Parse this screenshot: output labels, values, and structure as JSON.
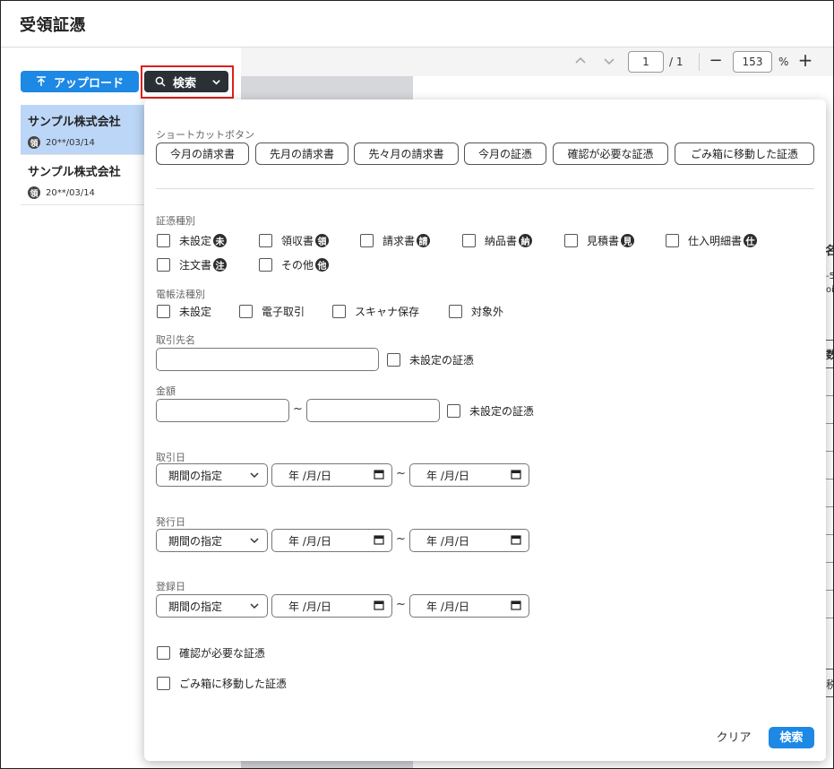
{
  "app": {
    "title": "受領証憑"
  },
  "sidebar": {
    "upload_label": "アップロード",
    "search_label": "検索",
    "items": [
      {
        "title": "サンプル株式会社",
        "badge": "領",
        "date": "20**/03/14",
        "selected": true
      },
      {
        "title": "サンプル株式会社",
        "badge": "領",
        "date": "20**/03/14",
        "selected": false
      }
    ]
  },
  "viewer": {
    "page": "1",
    "page_total": "/ 1",
    "zoom": "153",
    "zoom_unit": "%",
    "minus": "−",
    "plus": "+",
    "doc_fragments": [
      "名",
      "-5",
      "oi",
      "数",
      "税"
    ]
  },
  "search_panel": {
    "shortcut_label": "ショートカットボタン",
    "shortcuts": [
      "今月の請求書",
      "先月の請求書",
      "先々月の請求書",
      "今月の証憑",
      "確認が必要な証憑",
      "ごみ箱に移動した証憑"
    ],
    "doc_type_label": "証憑種別",
    "doc_types": [
      {
        "label": "未設定",
        "tag": "未"
      },
      {
        "label": "領収書",
        "tag": "領"
      },
      {
        "label": "請求書",
        "tag": "請"
      },
      {
        "label": "納品書",
        "tag": "納"
      },
      {
        "label": "見積書",
        "tag": "見"
      },
      {
        "label": "仕入明細書",
        "tag": "仕"
      },
      {
        "label": "注文書",
        "tag": "注"
      },
      {
        "label": "その他",
        "tag": "他"
      }
    ],
    "ledger_label": "電帳法種別",
    "ledger_types": [
      "未設定",
      "電子取引",
      "スキャナ保存",
      "対象外"
    ],
    "partner_label": "取引先名",
    "partner_unset": "未設定の証憑",
    "amount_label": "金額",
    "amount_tilde": "~",
    "amount_unset": "未設定の証憑",
    "date_tilde": "~",
    "dates": [
      {
        "label": "取引日",
        "period": "期間の指定",
        "from": "年 /月/日",
        "to": "年 /月/日"
      },
      {
        "label": "発行日",
        "period": "期間の指定",
        "from": "年 /月/日",
        "to": "年 /月/日"
      },
      {
        "label": "登録日",
        "period": "期間の指定",
        "from": "年 /月/日",
        "to": "年 /月/日"
      }
    ],
    "needs_confirm": "確認が必要な証憑",
    "in_trash": "ごみ箱に移動した証憑",
    "clear_label": "クリア",
    "submit_label": "検索"
  },
  "colors": {
    "primary": "#1e88e5",
    "dark": "#2b2f36",
    "highlight": "#e01e1e",
    "selected_row": "#bcd6f7"
  },
  "icons": [
    "arrow-up-upload-icon",
    "search-icon",
    "chevron-down-icon",
    "chevron-up-icon",
    "calendar-icon"
  ]
}
